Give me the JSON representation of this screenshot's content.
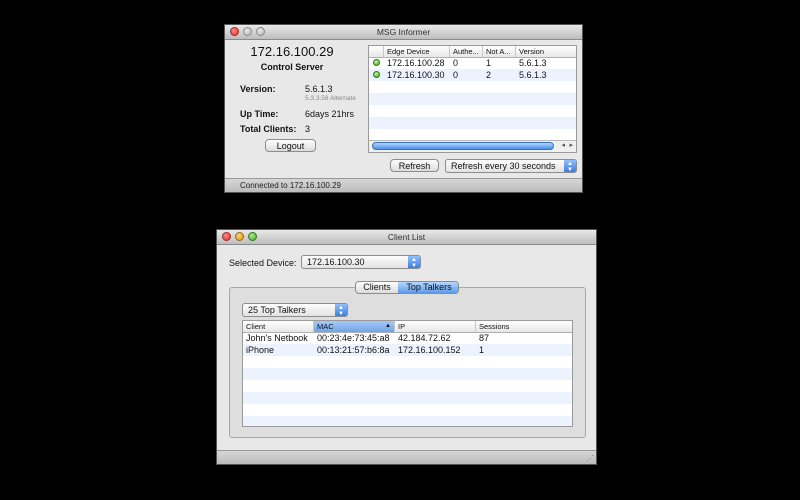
{
  "informer": {
    "title": "MSG Informer",
    "ip": "172.16.100.29",
    "role": "Control Server",
    "version_label": "Version:",
    "version_value": "5.6.1.3",
    "version_alt": "5.3.3.58 Alternate",
    "uptime_label": "Up Time:",
    "uptime_value": "6days 21hrs",
    "clients_label": "Total Clients:",
    "clients_value": "3",
    "logout_label": "Logout",
    "status": "Connected to 172.16.100.29",
    "refresh_label": "Refresh",
    "refresh_interval": "Refresh every 30 seconds",
    "table": {
      "headers": [
        "Edge Device",
        "Authe...",
        "Not A...",
        "Version"
      ],
      "rows": [
        {
          "status": "online",
          "device": "172.16.100.28",
          "auth": "0",
          "notauth": "1",
          "version": "5.6.1.3"
        },
        {
          "status": "online",
          "device": "172.16.100.30",
          "auth": "0",
          "notauth": "2",
          "version": "5.6.1.3"
        }
      ]
    }
  },
  "client_list": {
    "title": "Client List",
    "selected_label": "Selected Device:",
    "selected_value": "172.16.100.30",
    "tabs": [
      "Clients",
      "Top Talkers"
    ],
    "active_tab": "Top Talkers",
    "talkers_select": "25 Top Talkers",
    "table": {
      "headers": [
        "Client",
        "MAC",
        "IP",
        "Sessions"
      ],
      "sorted_column": "MAC",
      "rows": [
        {
          "client": "John's Netbook",
          "mac": "00:23:4e:73:45:a8",
          "ip": "42.184.72.62",
          "sessions": "87"
        },
        {
          "client": "iPhone",
          "mac": "00:13:21:57:b6:8a",
          "ip": "172.16.100.152",
          "sessions": "1"
        }
      ]
    }
  },
  "colors": {
    "online": "#3fa21f",
    "selection": "#6ea4ea"
  }
}
